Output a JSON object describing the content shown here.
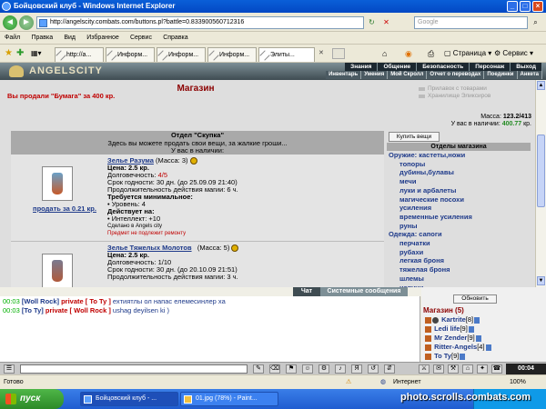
{
  "window": {
    "title": "Бойцовский клуб - Windows Internet Explorer"
  },
  "browser": {
    "url": "http://angelscity.combats.com/buttons.pl?battle=0.833900560712316",
    "search_placeholder": "Google",
    "menu": [
      "Файл",
      "Правка",
      "Вид",
      "Избранное",
      "Сервис",
      "Справка"
    ],
    "tabs": [
      "http://a...",
      "Информ...",
      "Информ...",
      "Информ...",
      "Элиты..."
    ],
    "toolbar_page": "Страница",
    "toolbar_tools": "Сервис"
  },
  "game": {
    "logo": "ANGELSCITY",
    "main_menu": [
      "Знания",
      "Общение",
      "Безопасность",
      "Персонаж",
      "Выход"
    ],
    "sub_menu": [
      "Инвентарь",
      "Умения",
      "Мой Скролл",
      "Отчет о переводах",
      "Поединки",
      "Анкета"
    ]
  },
  "shop": {
    "title": "Магазин",
    "sold_message": "Вы продали \"Бумага\" за 400 кр.",
    "links": [
      "Прилавок с товарами",
      "Хранилище Эликсиров"
    ],
    "mass_label": "Масса:",
    "mass_value": "123.2/413",
    "money_label": "У вас в наличии:",
    "money_value": "400.77",
    "money_unit": "кр.",
    "panel_title": "Отдел \"Скупка\"",
    "panel_line1": "Здесь вы можете продать свои вещи, за жалкие гроши...",
    "panel_line2": "У вас в наличии:",
    "buy_button": "Купить вещи",
    "departments_title": "Отделы магазина",
    "departments": [
      {
        "label": "Оружие: кастеты,ножи",
        "type": "cat"
      },
      {
        "label": "топоры",
        "type": "sub"
      },
      {
        "label": "дубины,булавы",
        "type": "sub"
      },
      {
        "label": "мечи",
        "type": "sub"
      },
      {
        "label": "луки и арбалеты",
        "type": "sub"
      },
      {
        "label": "магические посохи",
        "type": "sub"
      },
      {
        "label": "усиления",
        "type": "sub"
      },
      {
        "label": "временные усиления",
        "type": "sub"
      },
      {
        "label": "руны",
        "type": "sub"
      },
      {
        "label": "Одежда: сапоги",
        "type": "cat"
      },
      {
        "label": "перчатки",
        "type": "sub"
      },
      {
        "label": "рубахи",
        "type": "sub"
      },
      {
        "label": "легкая броня",
        "type": "sub"
      },
      {
        "label": "тяжелая броня",
        "type": "sub"
      },
      {
        "label": "шлемы",
        "type": "sub"
      },
      {
        "label": "наручи",
        "type": "sub"
      },
      {
        "label": "пояса",
        "type": "sub"
      },
      {
        "label": "поножи",
        "type": "sub"
      }
    ],
    "items": [
      {
        "name": "Зелье Разума",
        "mass": "(Масса: 3)",
        "price": "Цена: 2.5 кр.",
        "durability_label": "Долговечность:",
        "durability_value": "4/5",
        "expiry": "Срок годности: 30 дн. (до 25.09.09 21:40)",
        "duration": "Продолжительность действия магии: 6 ч.",
        "req_title": "Требуется минимальное:",
        "req_line": "• Уровень: 4",
        "acts_title": "Действует на:",
        "acts_line": "• Интеллект: +10",
        "made": "Сделано в Angels city",
        "no_repair": "Предмет не подлежит ремонту",
        "sell": "продать за 0.21 кр."
      },
      {
        "name": "Зелье Тяжелых Молотов",
        "mass": "(Масса: 5)",
        "price": "Цена: 2.5 кр.",
        "durability_label": "Долговечность:",
        "durability_value": "1/10",
        "expiry": "Срок годности: 30 дн. (до 20.10.09 21:51)",
        "duration": "Продолжительность действия магии: 3 ч."
      }
    ]
  },
  "chat": {
    "tab_chat": "Чат",
    "tab_system": "Системные сообщения",
    "lines": [
      {
        "time": "00:03",
        "from": "[Woll Rock]",
        "private": "private [ To Ty ]",
        "text": "ехтиятлы ол напас елемесинлер ха"
      },
      {
        "time": "00:03",
        "from": "[To Ty]",
        "private": "private [ Woll Rock ]",
        "text": "ushag deyilsen ki )"
      }
    ]
  },
  "online": {
    "refresh": "Обновить",
    "location": "Магазин (5)",
    "players": [
      {
        "name": "Kartrite",
        "level": "[8]"
      },
      {
        "name": "Ledi life",
        "level": "[9]"
      },
      {
        "name": "Mr Zender",
        "level": "[9]"
      },
      {
        "name": "Ritter-Angels",
        "level": "[4]"
      },
      {
        "name": "To Ty",
        "level": "[9]"
      }
    ]
  },
  "clock": "00:04",
  "statusbar": {
    "left": "Готово",
    "zone": "Интернет",
    "zoom": "100%"
  },
  "taskbar": {
    "start": "пуск",
    "tasks": [
      "Бойцовский клуб - ...",
      "01.jpg (78%) - Paint..."
    ],
    "watermark": "photo.scrolls.combats.com"
  }
}
